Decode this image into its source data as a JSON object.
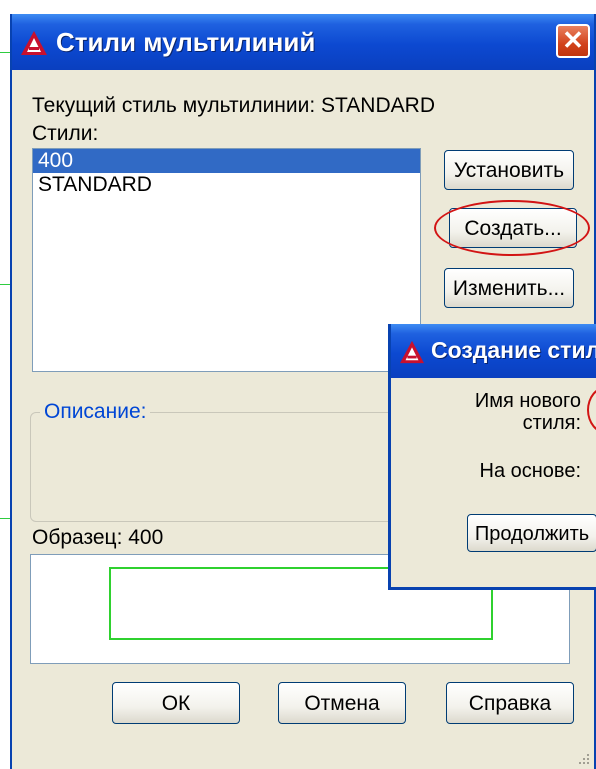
{
  "main_dialog": {
    "title": "Стили мультилиний",
    "current_style_label": "Текущий стиль мультилинии: STANDARD",
    "styles_label": "Стили:",
    "styles": [
      {
        "name": "400",
        "selected": true
      },
      {
        "name": "STANDARD",
        "selected": false
      }
    ],
    "buttons": {
      "set": "Установить",
      "create": "Создать...",
      "modify": "Изменить..."
    },
    "description_label": "Описание:",
    "preview_label": "Образец: 400",
    "footer": {
      "ok": "ОК",
      "cancel": "Отмена",
      "help": "Справка"
    }
  },
  "sub_dialog": {
    "title": "Создание стиля",
    "new_style_name_label_line1": "Имя нового",
    "new_style_name_label_line2": "стиля:",
    "based_on_label": "На основе:",
    "continue_button": "Продолжить"
  },
  "icons": {
    "app_logo": "autocad-logo-icon",
    "close": "close-icon"
  },
  "colors": {
    "titlebar": "#0a48d0",
    "selection": "#316ac5",
    "annotation": "#d21414",
    "preview_line": "#2fd12f",
    "group_title": "#0046d5"
  }
}
